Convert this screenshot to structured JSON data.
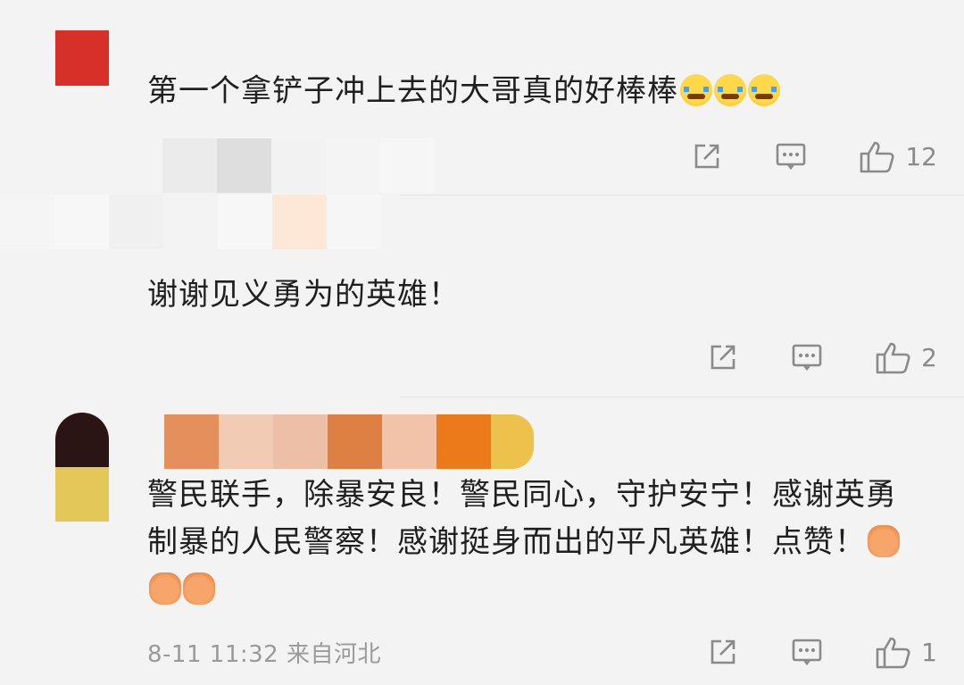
{
  "comments": [
    {
      "text": "第一个拿铲子冲上去的大哥真的好棒棒",
      "emoji": "crying-face-emoji",
      "meta": "",
      "likes": "12"
    },
    {
      "text": "谢谢见义勇为的英雄！",
      "meta": "",
      "likes": "2"
    },
    {
      "text": "警民联手，除暴安良！警民同心，守护安宁！感谢英勇制暴的人民警察！感谢挺身而出的平凡英雄！点赞！",
      "emoji": "palms-together-emoji",
      "meta": "8-11 11:32 来自河北",
      "likes": "1"
    }
  ],
  "icons": {
    "share": "share-icon",
    "reply": "comment-icon",
    "like": "thumbs-up-icon"
  },
  "colors": {
    "background": "#f3f3f3",
    "text": "#1f1f1f",
    "muted": "#8a8a8a"
  }
}
